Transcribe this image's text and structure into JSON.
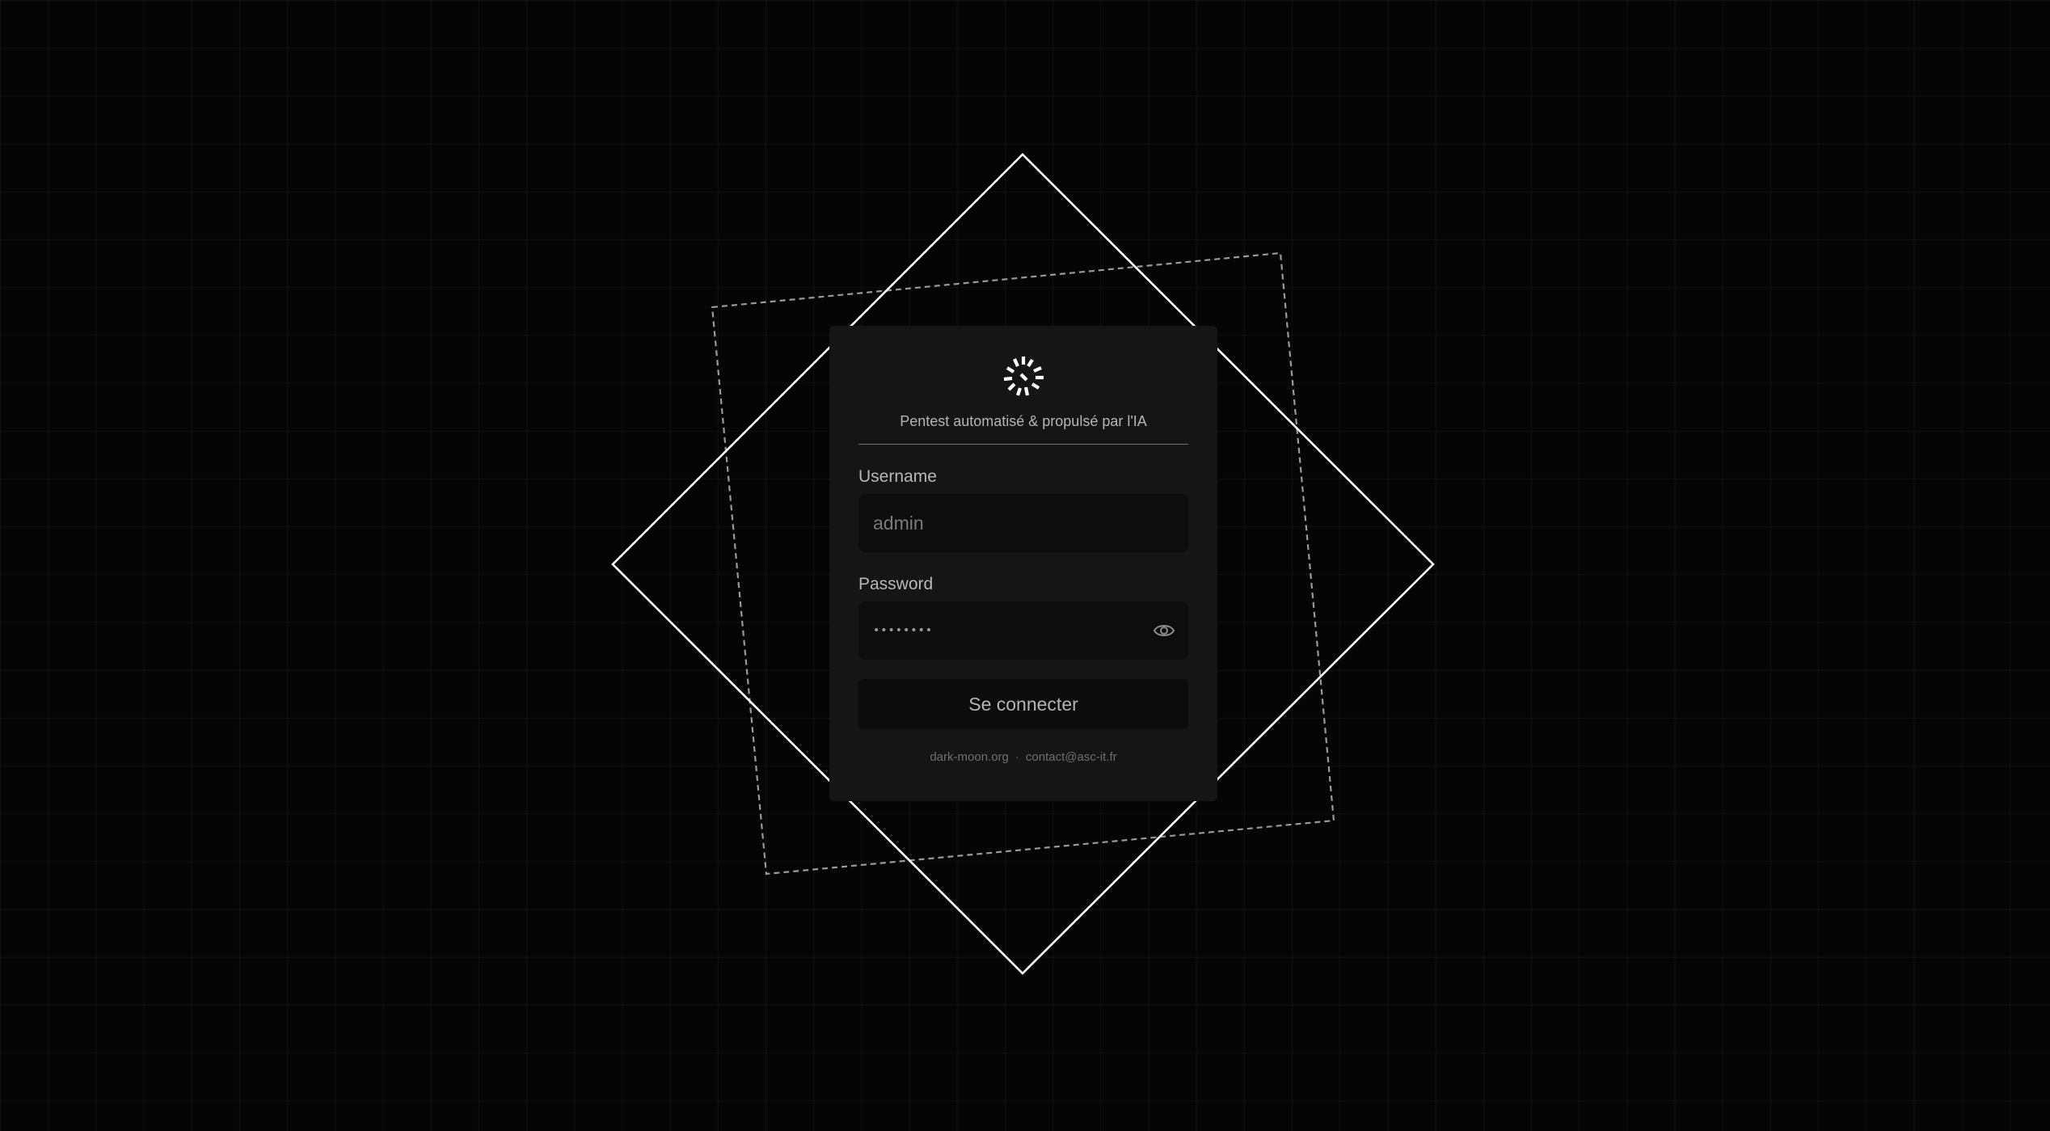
{
  "login": {
    "tagline": "Pentest automatisé & propulsé par l'IA",
    "username_label": "Username",
    "username_placeholder": "admin",
    "password_label": "Password",
    "password_value": "••••••••",
    "submit_label": "Se connecter"
  },
  "footer": {
    "link1": "dark-moon.org",
    "separator": "·",
    "link2": "contact@asc-it.fr"
  },
  "colors": {
    "background": "#050505",
    "card": "#151515",
    "input": "#0d0d0d",
    "accent_lines": "#ffffff"
  },
  "icons": {
    "logo": "spark-burst-icon",
    "password_toggle": "eye-icon"
  }
}
